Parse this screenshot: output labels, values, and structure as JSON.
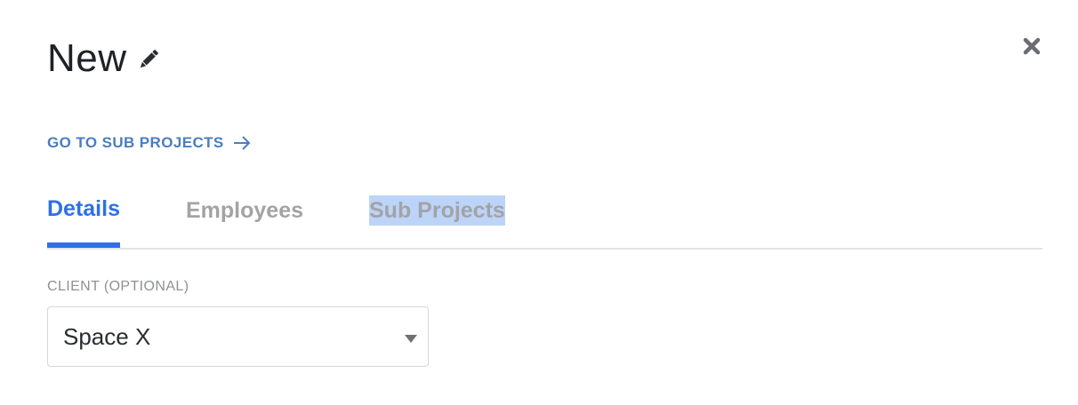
{
  "header": {
    "title": "New",
    "edit_icon": "pencil-icon",
    "close_icon": "close-icon"
  },
  "sub_projects_link": {
    "label": "GO TO SUB PROJECTS",
    "icon": "arrow-right-icon"
  },
  "tabs": [
    {
      "label": "Details",
      "active": true
    },
    {
      "label": "Employees",
      "active": false
    },
    {
      "label": "Sub Projects",
      "active": false,
      "text_selected": true
    }
  ],
  "client_field": {
    "label": "CLIENT (OPTIONAL)",
    "selected_value": "Space X"
  },
  "colors": {
    "accent": "#2f6fe8",
    "link": "#4a7ebf",
    "inactive_tab": "#a3a3a6",
    "selection_highlight": "#bcd4f8"
  }
}
